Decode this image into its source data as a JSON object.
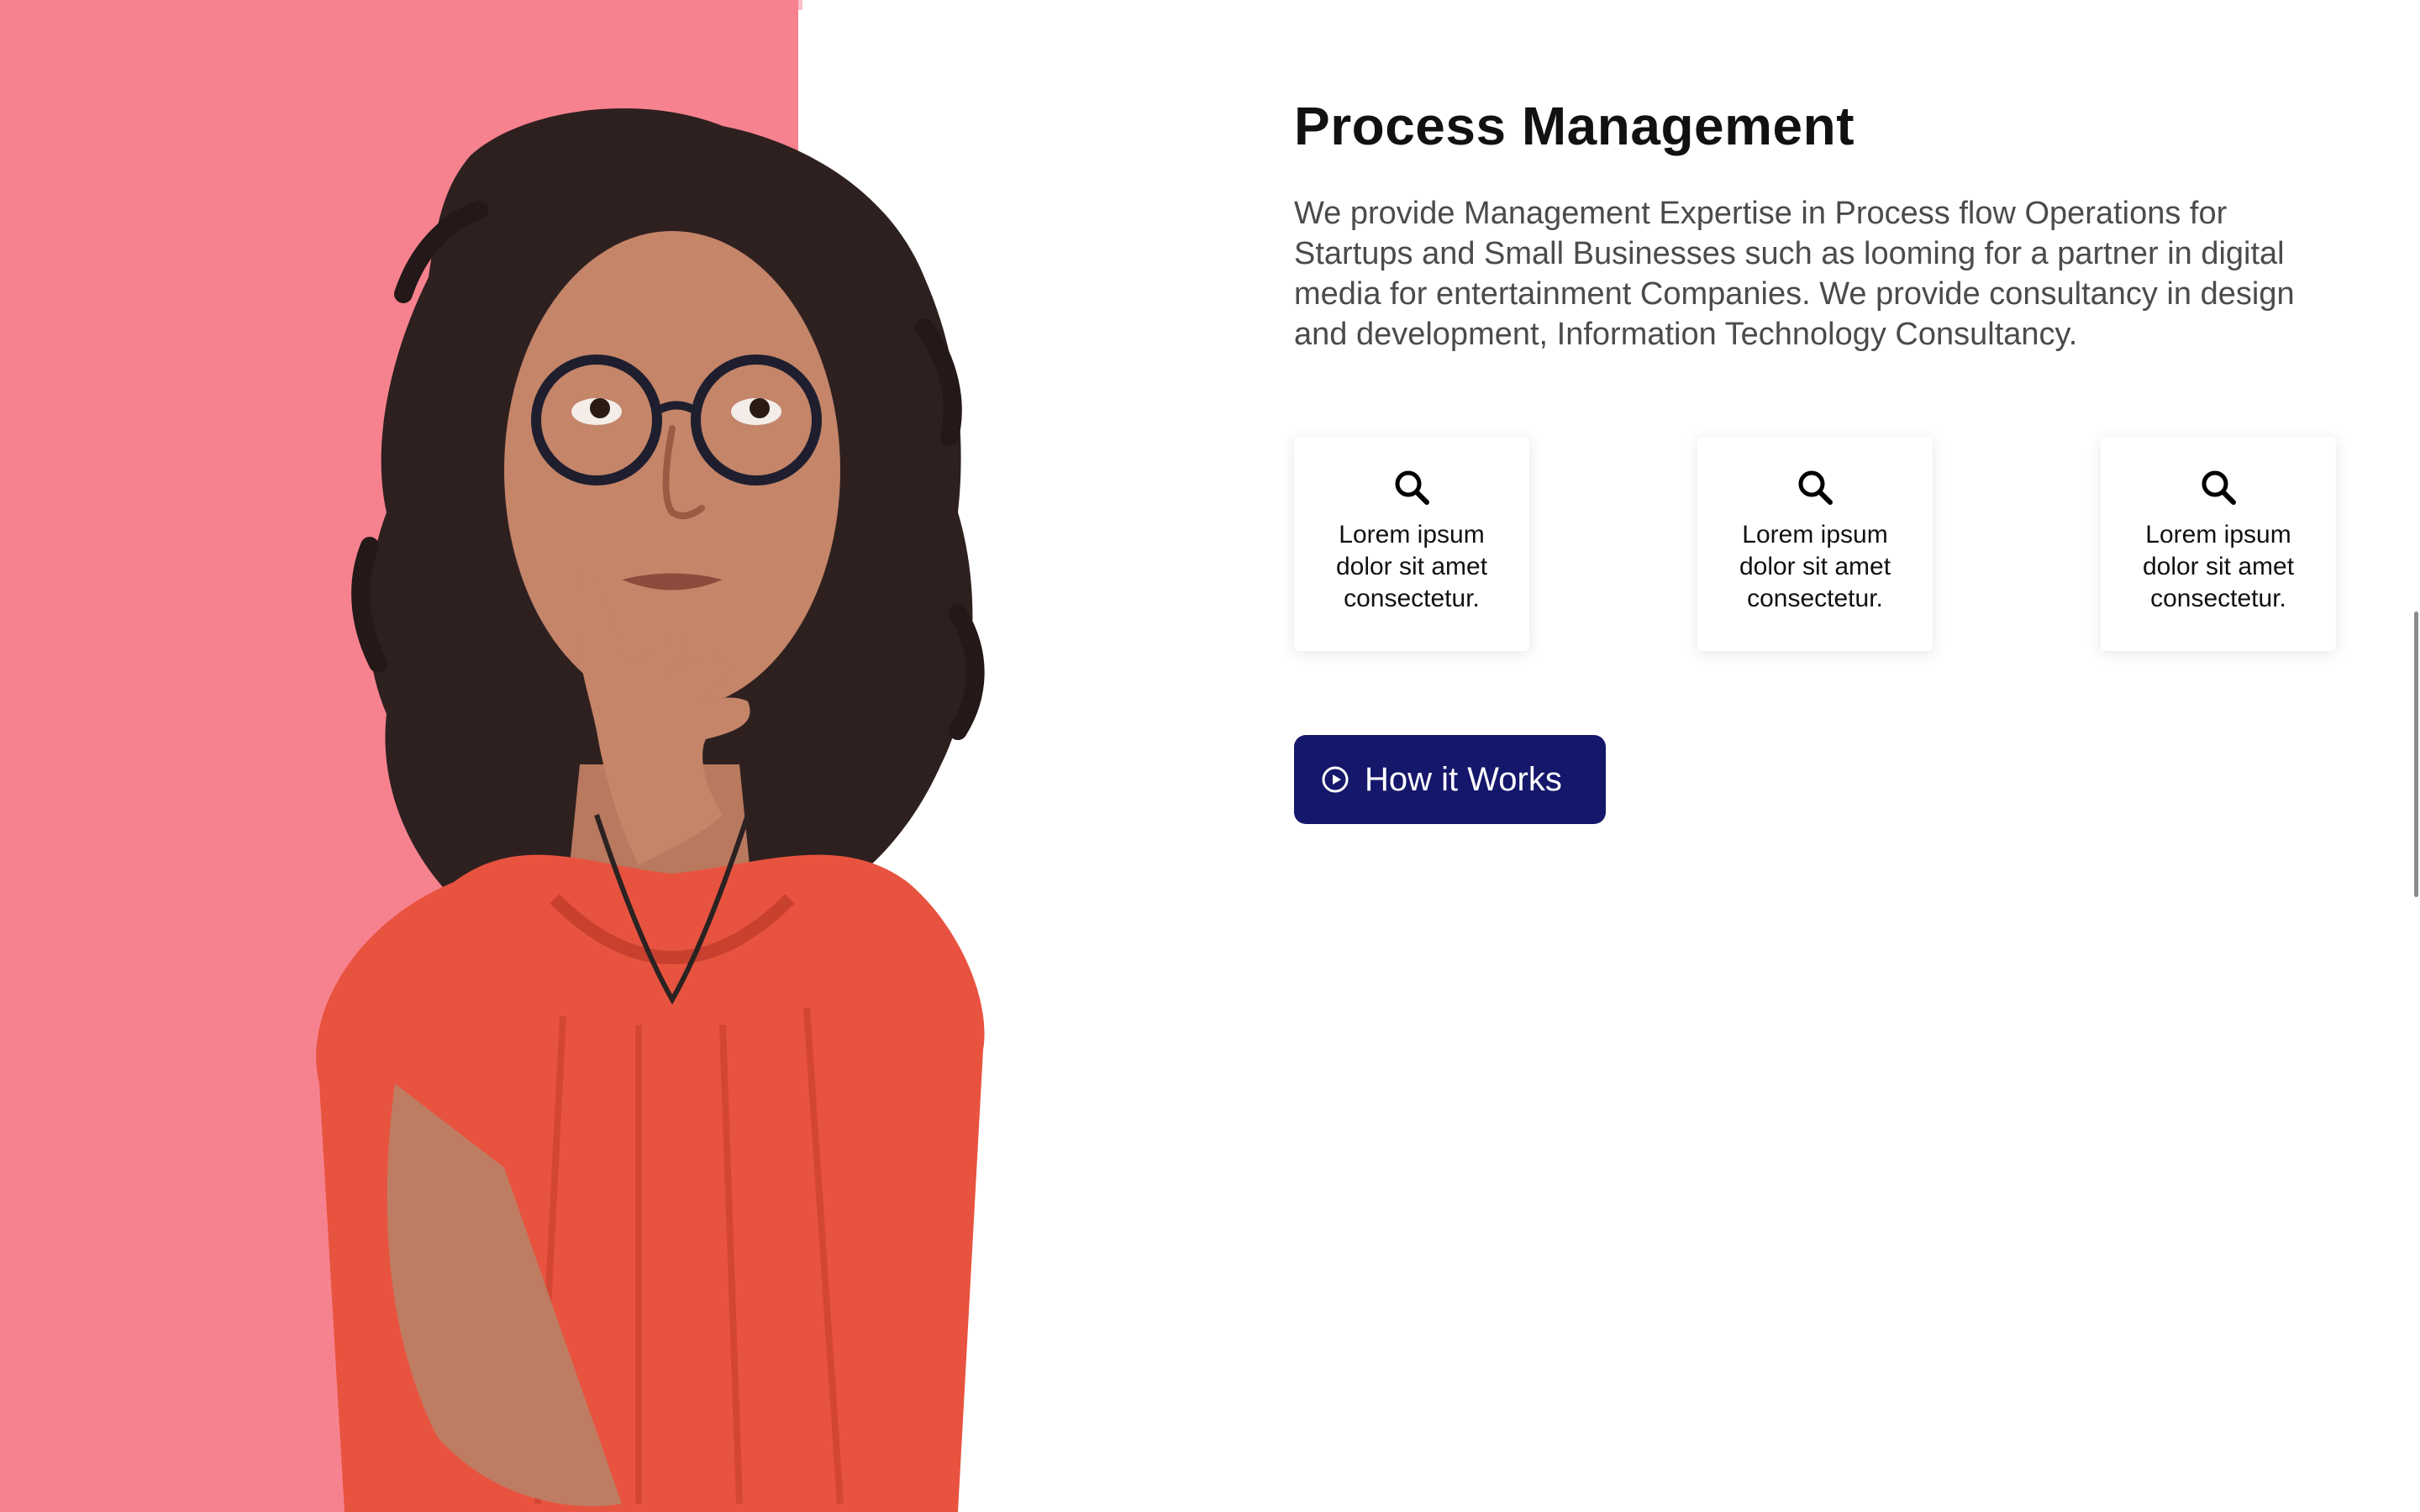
{
  "section": {
    "title": "Process Management",
    "description": "We provide Management Expertise in Process flow Operations for Startups and Small Businesses such as looming for a partner in digital media for entertainment Companies. We provide consultancy in design and development, Information Technology Consultancy."
  },
  "features": [
    {
      "icon": "search-icon",
      "text": "Lorem ipsum dolor sit amet consectetur."
    },
    {
      "icon": "search-icon",
      "text": "Lorem ipsum dolor sit amet consectetur."
    },
    {
      "icon": "search-icon",
      "text": "Lorem ipsum dolor sit amet consectetur."
    }
  ],
  "cta": {
    "label": "How it Works",
    "icon": "play-circle-icon"
  },
  "colors": {
    "accent_pink": "#f7828f",
    "button_navy": "#15176b"
  }
}
